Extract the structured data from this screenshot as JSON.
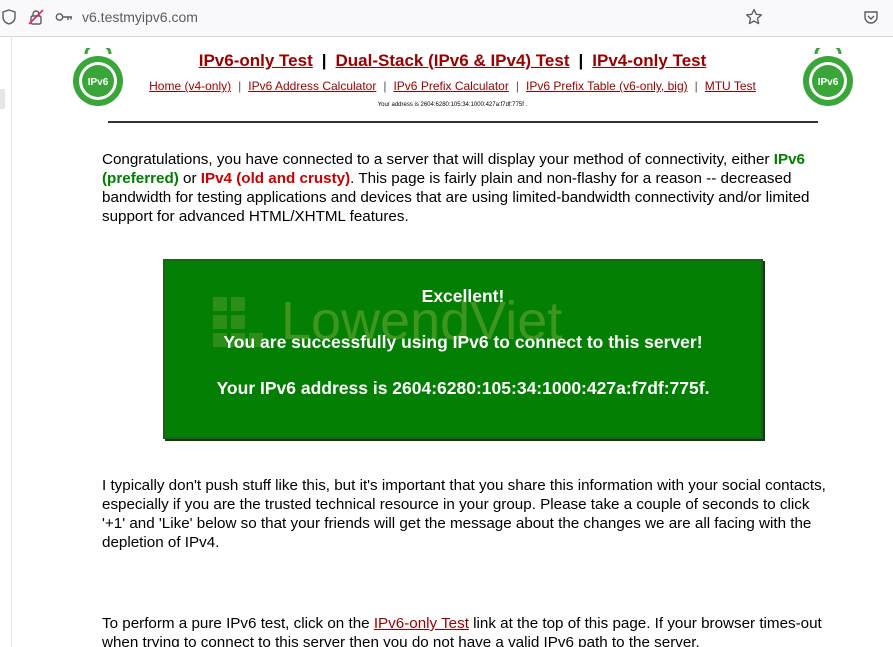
{
  "browser": {
    "url": "v6.testmyipv6.com",
    "icons": [
      "shield-icon",
      "insecure-lock-icon",
      "key-icon",
      "bookmark-star-icon",
      "pocket-icon"
    ]
  },
  "header": {
    "main_links": [
      "IPv6-only Test",
      "Dual-Stack (IPv6 & IPv4) Test",
      "IPv4-only Test"
    ],
    "separator": "|",
    "sub_links": [
      "Home (v4-only)",
      "IPv6 Address Calculator",
      "IPv6 Prefix Calculator",
      "IPv6 Prefix Table (v6-only, big)",
      "MTU Test"
    ],
    "small_address": "Your address is 2604:6280:105:34:1000:427a:f7df:775f .",
    "logo_text": "IPv6"
  },
  "intro": {
    "part1": "Congratulations, you have connected to a server that will display your method of connectivity, either ",
    "ipv6": "IPv6 (preferred)",
    "part2": " or ",
    "ipv4": "IPv4 (old and crusty)",
    "part3": ". This page is fairly plain and non-flashy for a reason -- decreased bandwidth for testing applications and devices that are using limited-bandwidth connectivity and/or limited support for advanced HTML/XHTML features."
  },
  "result": {
    "line1": "Excellent!",
    "line2": "You are successfully using IPv6 to connect to this server!",
    "line3": "Your IPv6 address is 2604:6280:105:34:1000:427a:f7df:775f.",
    "bg_color": "#037f03",
    "watermark": "LowendViet"
  },
  "share": {
    "text": "I typically don't push stuff like this, but it's important that you share this information with your social contacts, especially if you are the trusted technical resource in your group. Please take a couple of seconds to click '+1' and 'Like' below so that your friends will get the message about the changes we are all facing with the depletion of IPv4."
  },
  "pure_test": {
    "part1": "To perform a pure IPv6 test, click on the ",
    "link": "IPv6-only Test",
    "part2": " link at the top of this page. If your browser times-out when trying to connect to this server then you do not have a valid IPv6 path to the server."
  },
  "colors": {
    "link": "#990000",
    "ipv6": "#008000",
    "ipv4": "#cc0000"
  }
}
